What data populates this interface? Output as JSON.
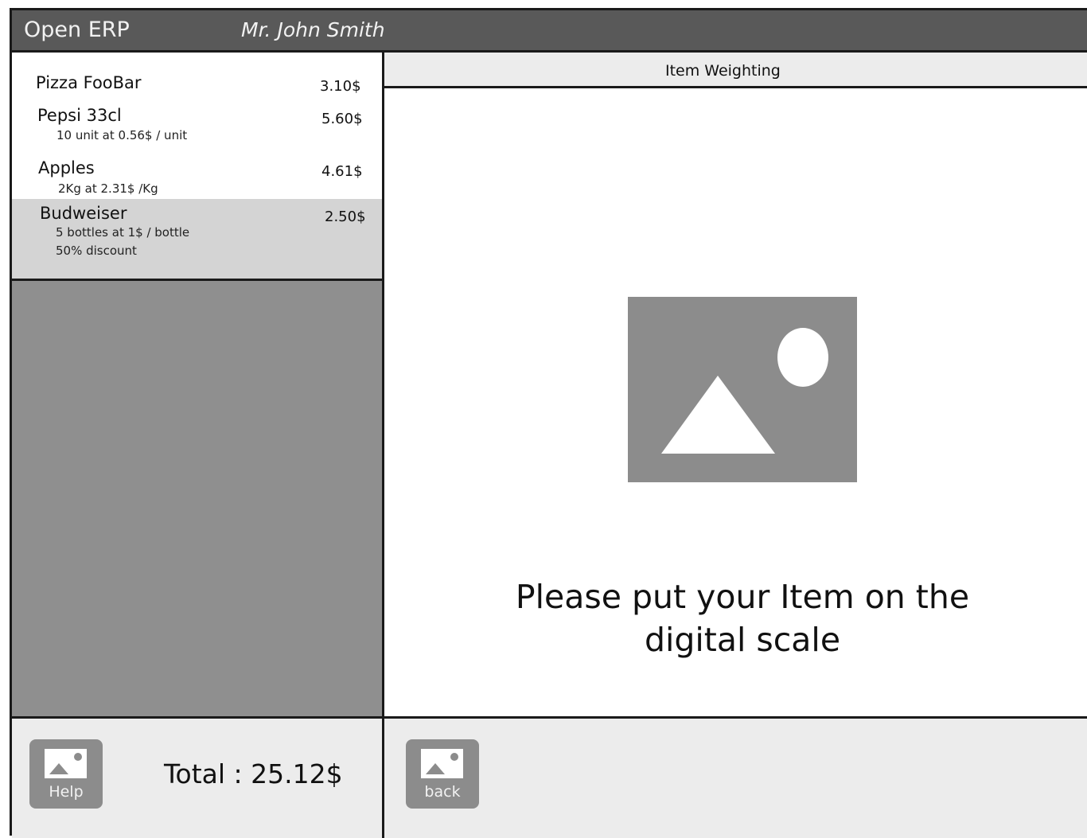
{
  "header": {
    "app_title": "Open ERP",
    "user_name": "Mr. John Smith"
  },
  "order": {
    "items": [
      {
        "name": "Pizza FooBar",
        "price": "3.10$",
        "details": []
      },
      {
        "name": "Pepsi 33cl",
        "price": "5.60$",
        "details": [
          "10 unit at 0.56$ / unit"
        ]
      },
      {
        "name": "Apples",
        "price": "4.61$",
        "details": [
          "2Kg at 2.31$ /Kg"
        ]
      },
      {
        "name": "Budweiser",
        "price": "2.50$",
        "details": [
          "5 bottles at 1$ / bottle",
          "50% discount"
        ],
        "selected": true
      }
    ]
  },
  "panel": {
    "title": "Item Weighting",
    "instruction_line1": "Please put your Item on the",
    "instruction_line2": "digital scale",
    "image_icon": "image-placeholder-icon"
  },
  "footer": {
    "help_label": "Help",
    "total": "Total : 25.12$",
    "back_label": "back"
  },
  "colors": {
    "titlebar": "#595959",
    "selected_row": "#d4d4d4",
    "filler": "#8f8f8f",
    "panel_bg": "#ececec"
  }
}
